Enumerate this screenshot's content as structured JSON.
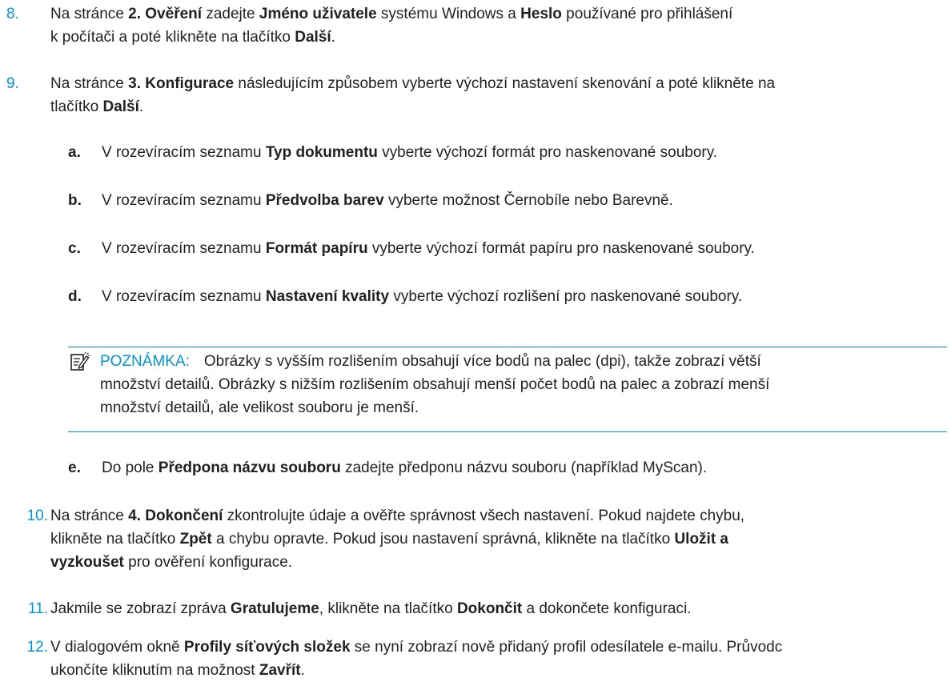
{
  "steps": {
    "s8": {
      "num": "8.",
      "t1": "Na stránce ",
      "b1": "2. Ověření",
      "t2": " zadejte ",
      "b2": "Jméno uživatele",
      "t3": " systému Windows a ",
      "b3": "Heslo",
      "t4": " používané pro přihlášení",
      "t5": "k počítači a poté klikněte na tlačítko ",
      "b4": "Další",
      "t6": "."
    },
    "s9": {
      "num": "9.",
      "t1": "Na stránce ",
      "b1": "3. Konfigurace",
      "t2": " následujícím způsobem vyberte výchozí nastavení skenování a poté klikněte na",
      "t3": "tlačítko ",
      "b2": "Další",
      "t4": "."
    },
    "sa": {
      "letter": "a.",
      "t1": "V rozevíracím seznamu ",
      "b1": "Typ dokumentu",
      "t2": " vyberte výchozí formát pro naskenované soubory."
    },
    "sb": {
      "letter": "b.",
      "t1": "V rozevíracím seznamu ",
      "b1": "Předvolba barev",
      "t2": " vyberte možnost Černobíle nebo Barevně."
    },
    "sc": {
      "letter": "c.",
      "t1": "V rozevíracím seznamu ",
      "b1": "Formát papíru",
      "t2": " vyberte výchozí formát papíru pro naskenované soubory."
    },
    "sd": {
      "letter": "d.",
      "t1": "V rozevíracím seznamu ",
      "b1": "Nastavení kvality",
      "t2": " vyberte výchozí rozlišení pro naskenované soubory."
    },
    "note": {
      "label": "POZNÁMKA:",
      "line1": "Obrázky s vyšším rozlišením obsahují více bodů na palec (dpi), takže zobrazí větší",
      "line2": "množství detailů. Obrázky s nižším rozlišením obsahují menší počet bodů na palec a zobrazí menší",
      "line3": "množství detailů, ale velikost souboru je menší."
    },
    "se": {
      "letter": "e.",
      "t1": "Do pole ",
      "b1": "Předpona názvu souboru",
      "t2": " zadejte předponu názvu souboru (například MyScan)."
    },
    "s10": {
      "num": "10.",
      "t1": "Na stránce ",
      "b1": "4. Dokončení",
      "t2": " zkontrolujte údaje a ověřte správnost všech nastavení. Pokud najdete chybu,",
      "t3": "klikněte na tlačítko ",
      "b2": "Zpět",
      "t4": " a chybu opravte. Pokud jsou nastavení správná, klikněte na tlačítko ",
      "b3": "Uložit a",
      "b4": "vyzkoušet",
      "t5": " pro ověření konfigurace."
    },
    "s11": {
      "num": "11.",
      "t1": "Jakmile se zobrazí zpráva ",
      "b1": "Gratulujeme",
      "t2": ", klikněte na tlačítko ",
      "b2": "Dokončit",
      "t3": " a dokončete konfiguraci."
    },
    "s12": {
      "num": "12.",
      "t1": "V dialogovém okně ",
      "b1": "Profily síťových složek",
      "t2": " se nyní zobrazí nově přidaný profil odesílatele e-mailu. Průvodc",
      "t3": "ukončíte kliknutím na možnost ",
      "b2": "Zavřít",
      "t4": "."
    }
  },
  "colors": {
    "accent": "#0096d6",
    "text": "#231f20"
  },
  "icons": {
    "note": "note-pencil-icon"
  }
}
